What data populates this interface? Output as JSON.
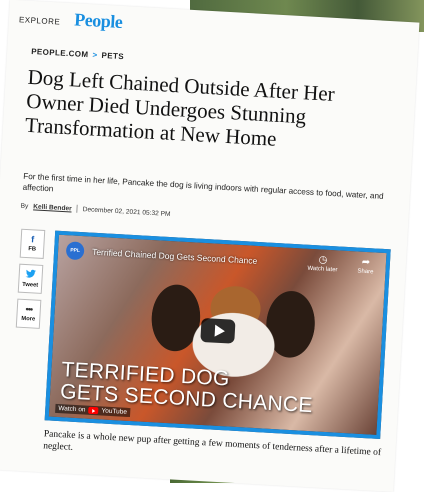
{
  "site": {
    "explore_label": "EXPLORE",
    "logo_text": "People",
    "brand_color": "#1a8fe0"
  },
  "breadcrumb": {
    "site": "PEOPLE.COM",
    "separator": ">",
    "section": "PETS"
  },
  "article": {
    "headline": "Dog Left Chained Outside After Her Owner Died Undergoes Stunning Transformation at New Home",
    "dek": "For the first time in her life, Pancake the dog is living indoors with regular access to food, water, and affection",
    "byline_prefix": "By",
    "author": "Kelli Bender",
    "date": "December 02, 2021 05:32 PM"
  },
  "share": {
    "facebook": {
      "icon": "f",
      "label": "FB"
    },
    "twitter": {
      "icon": "bird",
      "label": "Tweet"
    },
    "more": {
      "icon": "•••",
      "label": "More"
    }
  },
  "video": {
    "badge_text": "PPL",
    "title": "Terrified Chained Dog Gets Second Chance",
    "watch_later_label": "Watch later",
    "share_label": "Share",
    "overlay_caption_line1": "TERRIFIED DOG",
    "overlay_caption_line2": "GETS SECOND CHANCE",
    "watch_on_label": "Watch on",
    "youtube_label": "YouTube"
  },
  "caption": "Pancake is a whole new pup after getting a few moments of tenderness after a lifetime of neglect."
}
